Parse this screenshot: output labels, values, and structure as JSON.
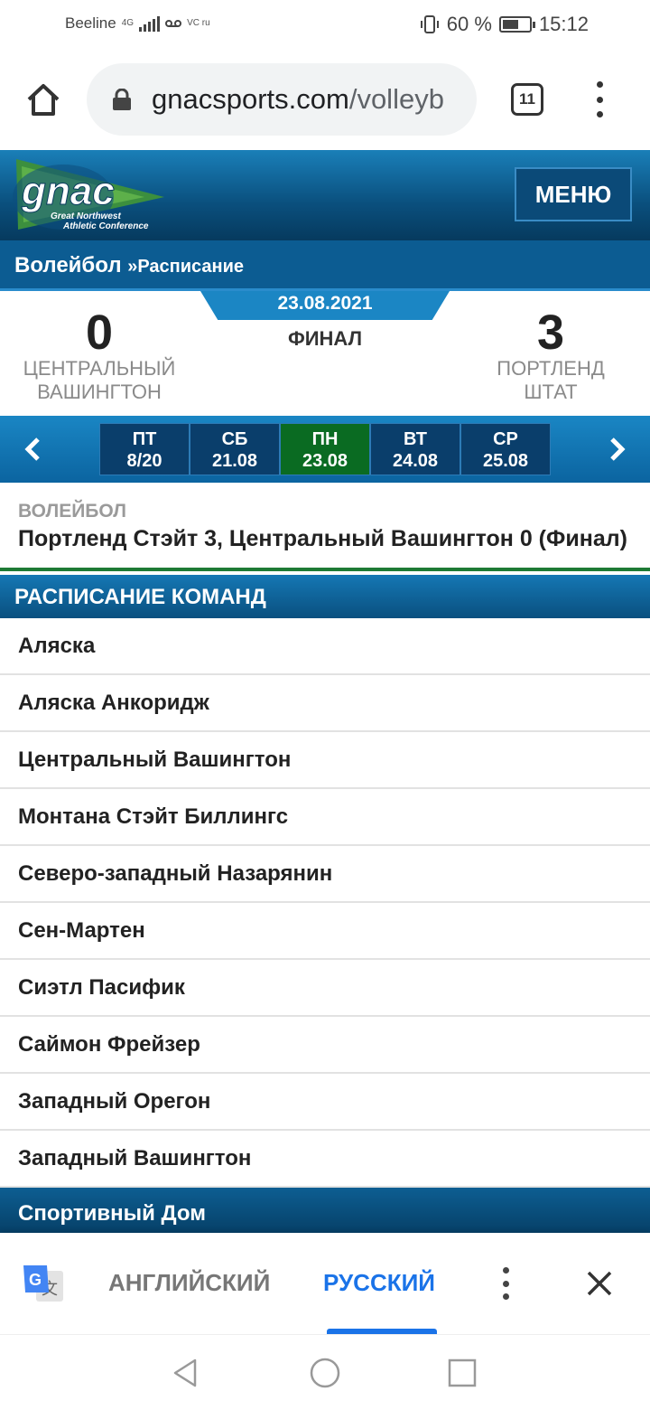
{
  "status_bar": {
    "carrier": "Beeline",
    "network": "4G",
    "indicators": "VC ru",
    "battery": "60 %",
    "battery_level": 0.6,
    "time": "15:12"
  },
  "browser": {
    "url_domain": "gnacsports.com",
    "url_path": "/volleyb",
    "tab_count": "11"
  },
  "site": {
    "logo_text": "gnac",
    "logo_subtitle_1": "Great Northwest",
    "logo_subtitle_2": "Athletic Conference",
    "menu_label": "МЕНЮ"
  },
  "breadcrumb": {
    "section": "Волейбол",
    "separator": "»",
    "page": "Расписание"
  },
  "scoreboard": {
    "date": "23.08.2021",
    "status": "ФИНАЛ",
    "home": {
      "score": "0",
      "name_line1": "ЦЕНТРАЛЬНЫЙ",
      "name_line2": "ВАШИНГТОН"
    },
    "away": {
      "score": "3",
      "name_line1": "ПОРТЛЕНД",
      "name_line2": "ШТАТ"
    }
  },
  "date_strip": {
    "days": [
      {
        "dow": "ПТ",
        "date": "8/20",
        "active": false
      },
      {
        "dow": "СБ",
        "date": "21.08",
        "active": false
      },
      {
        "dow": "ПН",
        "date": "23.08",
        "active": true
      },
      {
        "dow": "ВТ",
        "date": "24.08",
        "active": false
      },
      {
        "dow": "СР",
        "date": "25.08",
        "active": false
      }
    ]
  },
  "headline": {
    "sport": "ВОЛЕЙБОЛ",
    "text": "Портленд Стэйт 3, Центральный Вашингтон 0 (Финал)"
  },
  "team_schedule": {
    "title": "РАСПИСАНИЕ КОМАНД",
    "teams": [
      "Аляска",
      "Аляска Анкоридж",
      "Центральный Вашингтон",
      "Монтана Стэйт Биллингс",
      "Северо-западный Назарянин",
      "Сен-Мартен",
      "Сиэтл Пасифик",
      "Саймон Фрейзер",
      "Западный Орегон",
      "Западный Вашингтон"
    ]
  },
  "sports_home": "Спортивный Дом",
  "translate_bar": {
    "source_lang": "АНГЛИЙСКИЙ",
    "target_lang": "РУССКИЙ",
    "selected": "target"
  },
  "colors": {
    "site_blue": "#0c5c92",
    "active_day": "#0a6b22",
    "translate_accent": "#1a73e8"
  }
}
